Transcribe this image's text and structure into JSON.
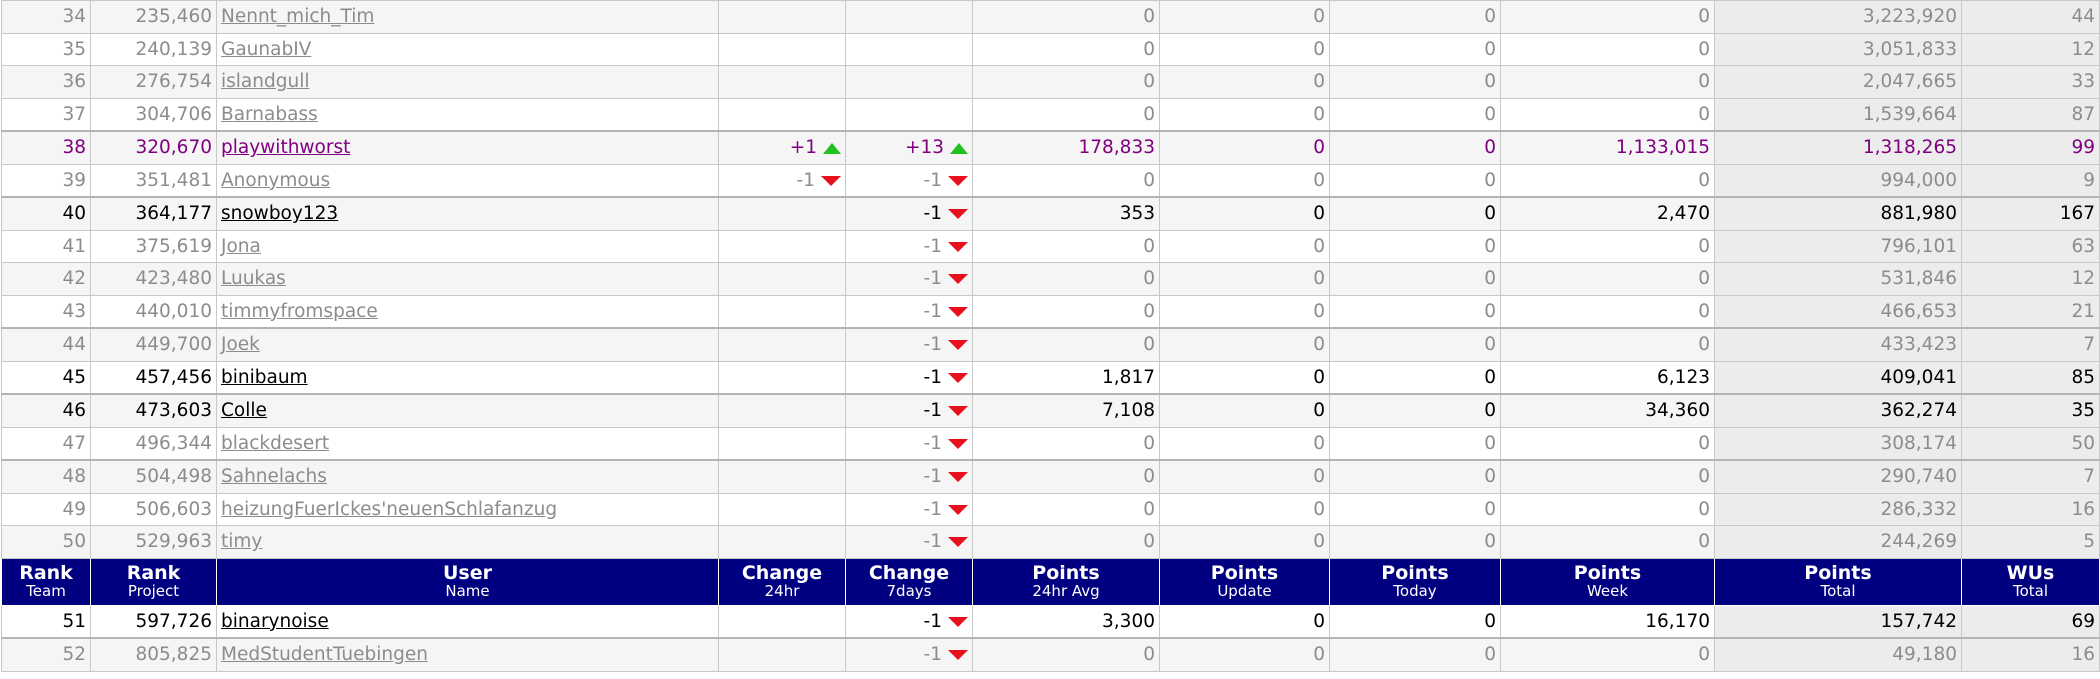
{
  "header": {
    "rank_team": [
      "Rank",
      "Team"
    ],
    "rank_project": [
      "Rank",
      "Project"
    ],
    "user": [
      "User",
      "Name"
    ],
    "change_24hr": [
      "Change",
      "24hr"
    ],
    "change_7days": [
      "Change",
      "7days"
    ],
    "points_24hr_avg": [
      "Points",
      "24hr Avg"
    ],
    "points_update": [
      "Points",
      "Update"
    ],
    "points_today": [
      "Points",
      "Today"
    ],
    "points_week": [
      "Points",
      "Week"
    ],
    "points_total": [
      "Points",
      "Total"
    ],
    "wus_total": [
      "WUs",
      "Total"
    ]
  },
  "rows_top": [
    {
      "rank": "34",
      "project": "235,460",
      "user": "Nennt_mich_Tim",
      "c24": "",
      "c24dir": "",
      "c7": "",
      "c7dir": "",
      "avg": "0",
      "upd": "0",
      "today": "0",
      "week": "0",
      "total": "3,223,920",
      "wus": "44",
      "style": "inactive",
      "zebra": true,
      "sep": false
    },
    {
      "rank": "35",
      "project": "240,139",
      "user": "GaunabIV",
      "c24": "",
      "c24dir": "",
      "c7": "",
      "c7dir": "",
      "avg": "0",
      "upd": "0",
      "today": "0",
      "week": "0",
      "total": "3,051,833",
      "wus": "12",
      "style": "inactive",
      "zebra": false,
      "sep": false
    },
    {
      "rank": "36",
      "project": "276,754",
      "user": "islandgull",
      "c24": "",
      "c24dir": "",
      "c7": "",
      "c7dir": "",
      "avg": "0",
      "upd": "0",
      "today": "0",
      "week": "0",
      "total": "2,047,665",
      "wus": "33",
      "style": "inactive",
      "zebra": true,
      "sep": false
    },
    {
      "rank": "37",
      "project": "304,706",
      "user": "Barnabass",
      "c24": "",
      "c24dir": "",
      "c7": "",
      "c7dir": "",
      "avg": "0",
      "upd": "0",
      "today": "0",
      "week": "0",
      "total": "1,539,664",
      "wus": "87",
      "style": "inactive",
      "zebra": false,
      "sep": false
    },
    {
      "rank": "38",
      "project": "320,670",
      "user": "playwithworst",
      "c24": "+1",
      "c24dir": "up",
      "c7": "+13",
      "c7dir": "up",
      "avg": "178,833",
      "upd": "0",
      "today": "0",
      "week": "1,133,015",
      "total": "1,318,265",
      "wus": "99",
      "style": "highlight",
      "zebra": true,
      "sep": true
    },
    {
      "rank": "39",
      "project": "351,481",
      "user": "Anonymous",
      "c24": "-1",
      "c24dir": "down",
      "c7": "-1",
      "c7dir": "down",
      "avg": "0",
      "upd": "0",
      "today": "0",
      "week": "0",
      "total": "994,000",
      "wus": "9",
      "style": "inactive",
      "zebra": false,
      "sep": false
    },
    {
      "rank": "40",
      "project": "364,177",
      "user": "snowboy123",
      "c24": "",
      "c24dir": "",
      "c7": "-1",
      "c7dir": "down",
      "avg": "353",
      "upd": "0",
      "today": "0",
      "week": "2,470",
      "total": "881,980",
      "wus": "167",
      "style": "active",
      "zebra": true,
      "sep": true
    },
    {
      "rank": "41",
      "project": "375,619",
      "user": "Jona",
      "c24": "",
      "c24dir": "",
      "c7": "-1",
      "c7dir": "down",
      "avg": "0",
      "upd": "0",
      "today": "0",
      "week": "0",
      "total": "796,101",
      "wus": "63",
      "style": "inactive",
      "zebra": false,
      "sep": false
    },
    {
      "rank": "42",
      "project": "423,480",
      "user": "Luukas",
      "c24": "",
      "c24dir": "",
      "c7": "-1",
      "c7dir": "down",
      "avg": "0",
      "upd": "0",
      "today": "0",
      "week": "0",
      "total": "531,846",
      "wus": "12",
      "style": "inactive",
      "zebra": true,
      "sep": false
    },
    {
      "rank": "43",
      "project": "440,010",
      "user": "timmyfromspace",
      "c24": "",
      "c24dir": "",
      "c7": "-1",
      "c7dir": "down",
      "avg": "0",
      "upd": "0",
      "today": "0",
      "week": "0",
      "total": "466,653",
      "wus": "21",
      "style": "inactive",
      "zebra": false,
      "sep": false
    },
    {
      "rank": "44",
      "project": "449,700",
      "user": "Joek",
      "c24": "",
      "c24dir": "",
      "c7": "-1",
      "c7dir": "down",
      "avg": "0",
      "upd": "0",
      "today": "0",
      "week": "0",
      "total": "433,423",
      "wus": "7",
      "style": "inactive",
      "zebra": true,
      "sep": true
    },
    {
      "rank": "45",
      "project": "457,456",
      "user": "binibaum",
      "c24": "",
      "c24dir": "",
      "c7": "-1",
      "c7dir": "down",
      "avg": "1,817",
      "upd": "0",
      "today": "0",
      "week": "6,123",
      "total": "409,041",
      "wus": "85",
      "style": "active",
      "zebra": false,
      "sep": false
    },
    {
      "rank": "46",
      "project": "473,603",
      "user": "Colle",
      "c24": "",
      "c24dir": "",
      "c7": "-1",
      "c7dir": "down",
      "avg": "7,108",
      "upd": "0",
      "today": "0",
      "week": "34,360",
      "total": "362,274",
      "wus": "35",
      "style": "active",
      "zebra": true,
      "sep": true
    },
    {
      "rank": "47",
      "project": "496,344",
      "user": "blackdesert",
      "c24": "",
      "c24dir": "",
      "c7": "-1",
      "c7dir": "down",
      "avg": "0",
      "upd": "0",
      "today": "0",
      "week": "0",
      "total": "308,174",
      "wus": "50",
      "style": "inactive",
      "zebra": false,
      "sep": false
    },
    {
      "rank": "48",
      "project": "504,498",
      "user": "Sahnelachs",
      "c24": "",
      "c24dir": "",
      "c7": "-1",
      "c7dir": "down",
      "avg": "0",
      "upd": "0",
      "today": "0",
      "week": "0",
      "total": "290,740",
      "wus": "7",
      "style": "inactive",
      "zebra": true,
      "sep": true
    },
    {
      "rank": "49",
      "project": "506,603",
      "user": "heizungFuerIckes'neuenSchlafanzug",
      "c24": "",
      "c24dir": "",
      "c7": "-1",
      "c7dir": "down",
      "avg": "0",
      "upd": "0",
      "today": "0",
      "week": "0",
      "total": "286,332",
      "wus": "16",
      "style": "inactive",
      "zebra": false,
      "sep": false
    },
    {
      "rank": "50",
      "project": "529,963",
      "user": "timy",
      "c24": "",
      "c24dir": "",
      "c7": "-1",
      "c7dir": "down",
      "avg": "0",
      "upd": "0",
      "today": "0",
      "week": "0",
      "total": "244,269",
      "wus": "5",
      "style": "inactive",
      "zebra": true,
      "sep": false
    }
  ],
  "rows_bottom": [
    {
      "rank": "51",
      "project": "597,726",
      "user": "binarynoise",
      "c24": "",
      "c24dir": "",
      "c7": "-1",
      "c7dir": "down",
      "avg": "3,300",
      "upd": "0",
      "today": "0",
      "week": "16,170",
      "total": "157,742",
      "wus": "69",
      "style": "active",
      "zebra": false,
      "sep": false
    },
    {
      "rank": "52",
      "project": "805,825",
      "user": "MedStudentTuebingen",
      "c24": "",
      "c24dir": "",
      "c7": "-1",
      "c7dir": "down",
      "avg": "0",
      "upd": "0",
      "today": "0",
      "week": "0",
      "total": "49,180",
      "wus": "16",
      "style": "inactive",
      "zebra": true,
      "sep": true
    }
  ],
  "colors": {
    "header_bg": "#000080",
    "highlight_text": "#800080",
    "inactive_text": "#8c8c8c",
    "arrow_up": "#22c020",
    "arrow_down": "#e8101c"
  }
}
